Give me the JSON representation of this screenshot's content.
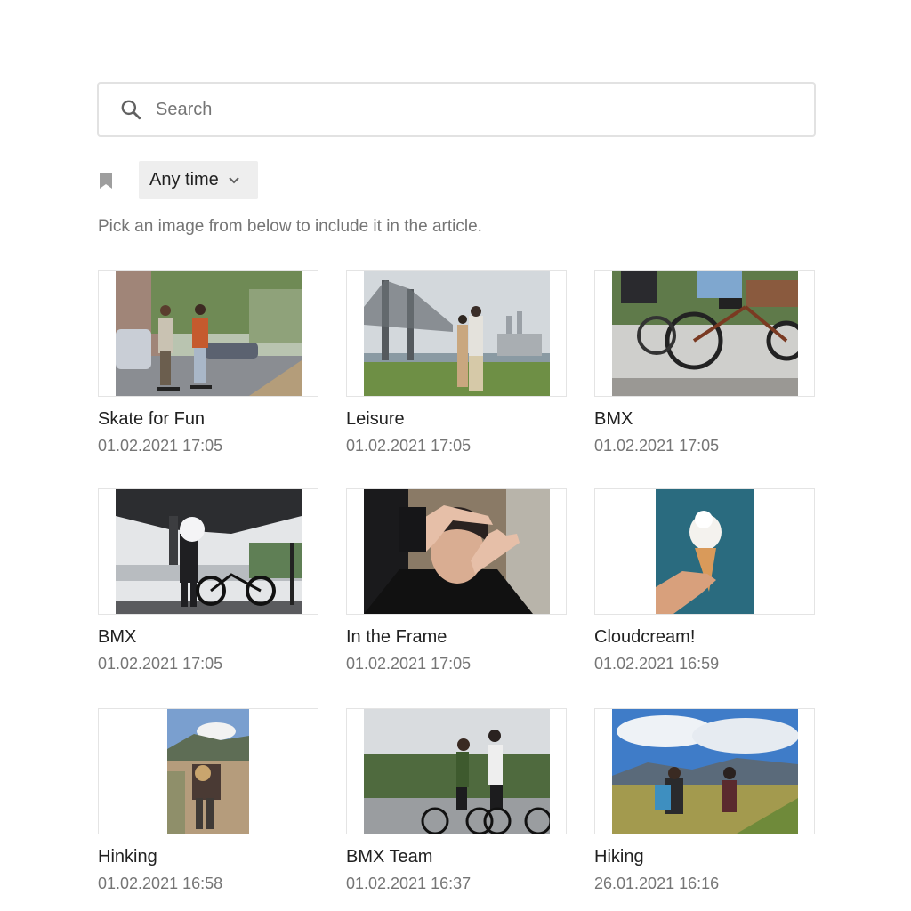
{
  "search": {
    "placeholder": "Search",
    "value": ""
  },
  "filters": {
    "bookmark_icon": "bookmark-icon",
    "time_filter_label": "Any time",
    "time_filter_icon": "chevron-down-icon"
  },
  "hint": "Pick an image from below to include it in the article.",
  "images": [
    {
      "title": "Skate for Fun",
      "date": "01.02.2021 17:05"
    },
    {
      "title": "Leisure",
      "date": "01.02.2021 17:05"
    },
    {
      "title": "BMX",
      "date": "01.02.2021 17:05"
    },
    {
      "title": "BMX",
      "date": "01.02.2021 17:05"
    },
    {
      "title": "In the Frame",
      "date": "01.02.2021 17:05"
    },
    {
      "title": "Cloudcream!",
      "date": "01.02.2021 16:59"
    },
    {
      "title": "Hinking",
      "date": "01.02.2021 16:58"
    },
    {
      "title": "BMX Team",
      "date": "01.02.2021 16:37"
    },
    {
      "title": "Hiking",
      "date": "26.01.2021 16:16"
    }
  ]
}
